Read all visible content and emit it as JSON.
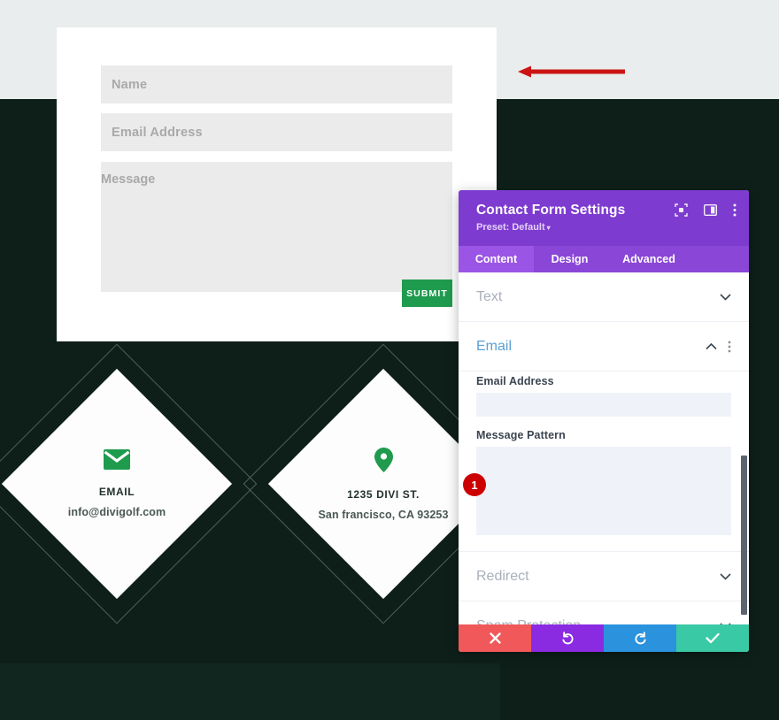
{
  "page": {
    "background_top": "#e9eded",
    "background_dark": "#0e1f19"
  },
  "contact_form": {
    "name_placeholder": "Name",
    "email_placeholder": "Email Address",
    "message_placeholder": "Message",
    "submit_label": "SUBMIT",
    "submit_color": "#1f9b4e"
  },
  "annotation": {
    "arrow_color": "#cc1414",
    "direction": "left"
  },
  "info_cards": [
    {
      "icon": "envelope-icon",
      "title": "EMAIL",
      "subtitle": "info@divigolf.com",
      "icon_color": "#1f9b4e"
    },
    {
      "icon": "map-pin-icon",
      "title": "1235 DIVI ST.",
      "subtitle": "San francisco, CA 93253",
      "icon_color": "#1f9b4e"
    }
  ],
  "settings_panel": {
    "title": "Contact Form Settings",
    "preset_label": "Preset: Default",
    "preset_caret": "▾",
    "header_icons": [
      "target-icon",
      "layout-columns-icon",
      "kebab-menu-icon"
    ],
    "accent_color": "#7e3bd0",
    "tabs": [
      {
        "label": "Content",
        "active": true
      },
      {
        "label": "Design",
        "active": false
      },
      {
        "label": "Advanced",
        "active": false
      }
    ],
    "sections": [
      {
        "label": "Text",
        "open": false
      },
      {
        "label": "Email",
        "open": true
      },
      {
        "label": "Redirect",
        "open": false
      },
      {
        "label": "Spam Protection",
        "open": false
      }
    ],
    "email_section": {
      "email_address_label": "Email Address",
      "email_address_value": "",
      "message_pattern_label": "Message Pattern",
      "message_pattern_value": ""
    },
    "badge": {
      "number": "1",
      "color": "#cc0000"
    },
    "actions": [
      {
        "name": "cancel",
        "icon": "close-icon",
        "color": "#f0585a"
      },
      {
        "name": "undo",
        "icon": "undo-icon",
        "color": "#8a2be2"
      },
      {
        "name": "redo",
        "icon": "redo-icon",
        "color": "#2b92dd"
      },
      {
        "name": "save",
        "icon": "check-icon",
        "color": "#39c9a5"
      }
    ]
  }
}
